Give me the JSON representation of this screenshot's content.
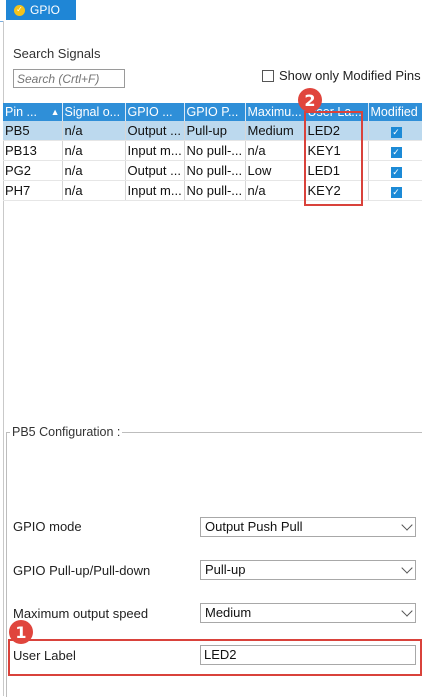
{
  "tab": {
    "label": "GPIO",
    "icon": "check-circle-icon"
  },
  "search": {
    "title": "Search Signals",
    "placeholder": "Search (Crtl+F)",
    "show_modified_label": "Show only Modified Pins"
  },
  "table": {
    "headers": [
      "Pin ...",
      "Signal o...",
      "GPIO ...",
      "GPIO P...",
      "Maximu...",
      "User La...",
      "Modified"
    ],
    "rows": [
      {
        "pin": "PB5",
        "signal": "n/a",
        "mode": "Output ...",
        "pull": "Pull-up",
        "speed": "Medium",
        "label": "LED2",
        "modified": true,
        "selected": true
      },
      {
        "pin": "PB13",
        "signal": "n/a",
        "mode": "Input m...",
        "pull": "No pull-...",
        "speed": "n/a",
        "label": "KEY1",
        "modified": true,
        "selected": false
      },
      {
        "pin": "PG2",
        "signal": "n/a",
        "mode": "Output ...",
        "pull": "No pull-...",
        "speed": "Low",
        "label": "LED1",
        "modified": true,
        "selected": false
      },
      {
        "pin": "PH7",
        "signal": "n/a",
        "mode": "Input m...",
        "pull": "No pull-...",
        "speed": "n/a",
        "label": "KEY2",
        "modified": true,
        "selected": false
      }
    ]
  },
  "callouts": [
    "1",
    "2"
  ],
  "config": {
    "title": "PB5 Configuration :",
    "gpio_mode_label": "GPIO mode",
    "gpio_mode_value": "Output Push Pull",
    "pull_label": "GPIO Pull-up/Pull-down",
    "pull_value": "Pull-up",
    "speed_label": "Maximum output speed",
    "speed_value": "Medium",
    "user_label_label": "User Label",
    "user_label_value": "LED2"
  },
  "colors": {
    "accent": "#1f86d6",
    "header": "#2f8fd8",
    "selected_row": "#bcd9ee",
    "callout": "#e0453d"
  }
}
